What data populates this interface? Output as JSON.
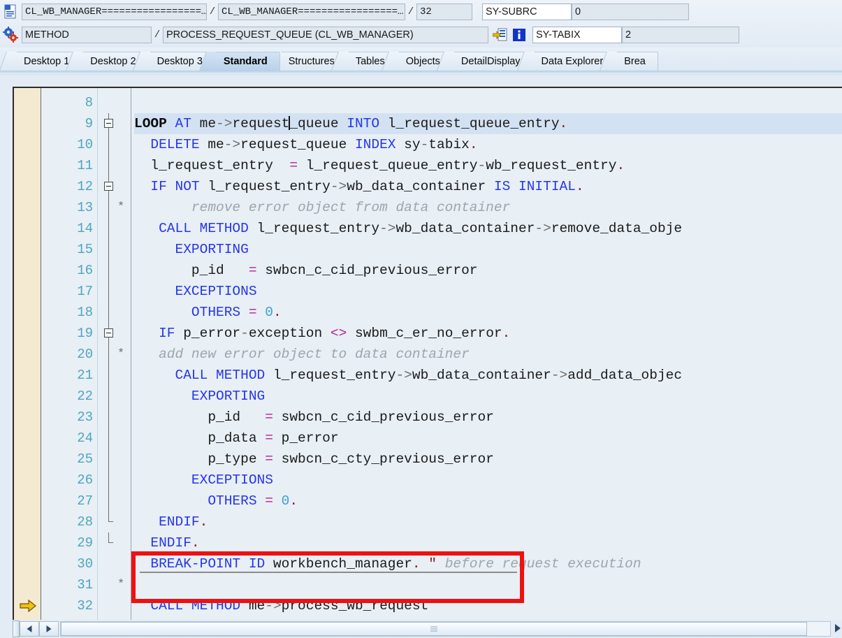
{
  "header": {
    "program_icon": "document-icon",
    "object_icon": "gears-icon",
    "row1": {
      "program": "CL_WB_MANAGER=================…",
      "separator": "/",
      "include": "CL_WB_MANAGER=================…",
      "separator2": "/",
      "line": "32"
    },
    "row2": {
      "type": "METHOD",
      "separator": "/",
      "name": "PROCESS_REQUEST_QUEUE (CL_WB_MANAGER)",
      "call_stack_icon": "call-stack-icon",
      "info_icon": "information-icon"
    },
    "status_fields": [
      {
        "label": "SY-SUBRC",
        "value": "0"
      },
      {
        "label": "SY-TABIX",
        "value": "2"
      }
    ]
  },
  "tabs": [
    {
      "label": "Desktop 1",
      "active": false
    },
    {
      "label": "Desktop 2",
      "active": false
    },
    {
      "label": "Desktop 3",
      "active": false
    },
    {
      "label": "Standard",
      "active": true
    },
    {
      "label": "Structures",
      "active": false
    },
    {
      "label": "Tables",
      "active": false
    },
    {
      "label": "Objects",
      "active": false
    },
    {
      "label": "DetailDisplay",
      "active": false
    },
    {
      "label": "Data Explorer",
      "active": false
    },
    {
      "label": "Brea",
      "active": false
    }
  ],
  "editor": {
    "current_line_marker": "execution-pointer-arrow",
    "current_line": 32,
    "cursor_line": 9,
    "highlight_box": {
      "color": "#ee1111",
      "from_line": 31,
      "to_line": 32
    },
    "lines": [
      {
        "n": "8",
        "text": ""
      },
      {
        "n": "9",
        "text": "  LOOP AT me->request_queue INTO l_request_queue_entry."
      },
      {
        "n": "10",
        "text": "    DELETE me->request_queue INDEX sy-tabix."
      },
      {
        "n": "11",
        "text": "    l_request_entry  = l_request_queue_entry-wb_request_entry."
      },
      {
        "n": "12",
        "text": "    IF NOT l_request_entry->wb_data_container IS INITIAL."
      },
      {
        "n": "13",
        "text": "       remove error object from data container"
      },
      {
        "n": "14",
        "text": "      CALL METHOD l_request_entry->wb_data_container->remove_data_obje"
      },
      {
        "n": "15",
        "text": "        EXPORTING"
      },
      {
        "n": "16",
        "text": "          p_id   = swbcn_c_cid_previous_error"
      },
      {
        "n": "17",
        "text": "        EXCEPTIONS"
      },
      {
        "n": "18",
        "text": "          OTHERS = 0."
      },
      {
        "n": "19",
        "text": "      IF p_error-exception <> swbm_c_er_no_error."
      },
      {
        "n": "20",
        "text": "        add new error object to data container"
      },
      {
        "n": "21",
        "text": "        CALL METHOD l_request_entry->wb_data_container->add_data_objec"
      },
      {
        "n": "22",
        "text": "          EXPORTING"
      },
      {
        "n": "23",
        "text": "            p_id   = swbcn_c_cid_previous_error"
      },
      {
        "n": "24",
        "text": "            p_data = p_error"
      },
      {
        "n": "25",
        "text": "            p_type = swbcn_c_cty_previous_error"
      },
      {
        "n": "26",
        "text": "          EXCEPTIONS"
      },
      {
        "n": "27",
        "text": "            OTHERS = 0."
      },
      {
        "n": "28",
        "text": "      ENDIF."
      },
      {
        "n": "29",
        "text": "    ENDIF."
      },
      {
        "n": "30",
        "text": "    BREAK-POINT ID workbench_manager. \" before request execution"
      },
      {
        "n": "31",
        "text": ""
      },
      {
        "n": "32",
        "text": "    CALL METHOD me->process_wb_request"
      }
    ]
  },
  "scrollbar": {
    "left_arrow_icon": "scroll-left-icon",
    "right_arrow_icon": "scroll-right-icon",
    "resize_grip_icon": "resize-grip-icon"
  },
  "colors": {
    "keyword": "#2636e8",
    "operator": "#b3238e",
    "number": "#3aa0d6",
    "comment": "#9ba6ad",
    "linenumber": "#4ea5bd",
    "highlight": "#ee1111",
    "active_line": "#d3e2f2",
    "breakpoint_margin": "#f4ead2"
  }
}
